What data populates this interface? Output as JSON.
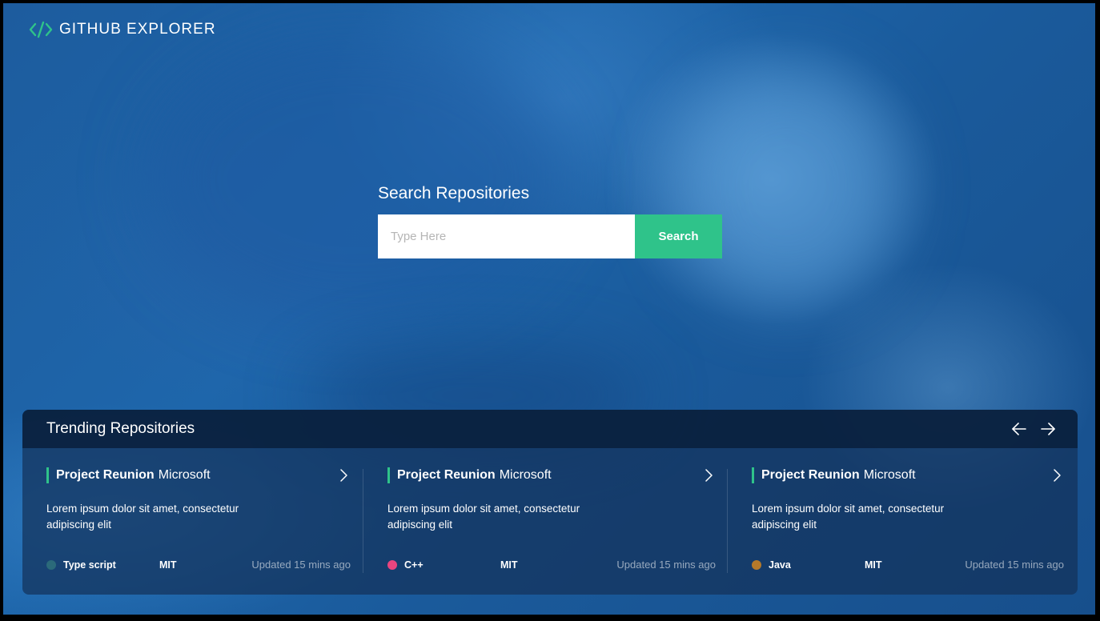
{
  "app": {
    "title": "GITHUB EXPLORER",
    "logo_icon": "code-brackets-icon",
    "accent_color": "#2fc38a"
  },
  "search": {
    "heading": "Search Repositories",
    "placeholder": "Type Here",
    "value": "",
    "button_label": "Search"
  },
  "trending": {
    "title": "Trending Repositories",
    "prev_icon": "arrow-left-icon",
    "next_icon": "arrow-right-icon",
    "cards": [
      {
        "name": "Project Reunion",
        "owner": "Microsoft",
        "description": "Lorem ipsum dolor sit amet, consectetur adipiscing elit",
        "language": "Type script",
        "language_color": "#2b6a7a",
        "license": "MIT",
        "updated": "Updated 15 mins ago"
      },
      {
        "name": "Project Reunion",
        "owner": "Microsoft",
        "description": "Lorem ipsum dolor sit amet, consectetur adipiscing elit",
        "language": "C++",
        "language_color": "#e9457f",
        "license": "MIT",
        "updated": "Updated 15 mins ago"
      },
      {
        "name": "Project Reunion",
        "owner": "Microsoft",
        "description": "Lorem ipsum dolor sit amet, consectetur adipiscing elit",
        "language": "Java",
        "language_color": "#b5792a",
        "license": "MIT",
        "updated": "Updated 15 mins ago"
      }
    ]
  }
}
